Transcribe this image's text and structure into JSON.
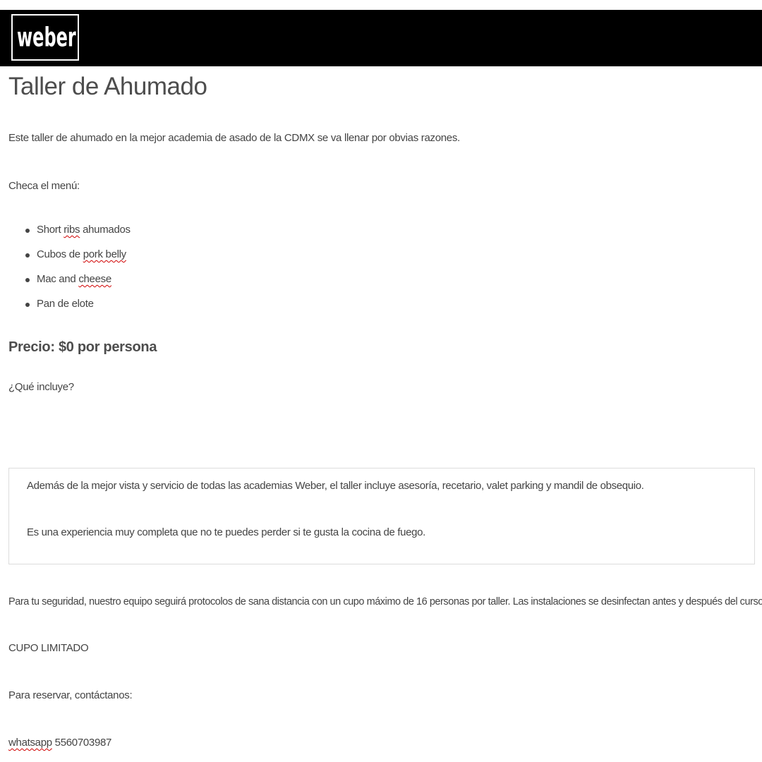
{
  "header": {
    "logo_text": "weber",
    "logo_icon": "kettle-grill-icon",
    "background_color": "#000000",
    "accent_color": "#e31b23"
  },
  "page": {
    "title": "Taller de Ahumado",
    "intro": "Este taller de ahumado en la mejor academia de asado de la CDMX se va llenar por obvias razones.",
    "menu_label": "Checa el menú:",
    "menu_items": [
      {
        "before": "Short ",
        "flagged": "ribs",
        "after": " ahumados"
      },
      {
        "before": "Cubos de ",
        "flagged": "pork belly",
        "after": ""
      },
      {
        "before": "Mac and ",
        "flagged": "cheese",
        "after": ""
      },
      {
        "before": "Pan de elote",
        "flagged": "",
        "after": ""
      }
    ],
    "price": "Precio: $0 por persona",
    "includes_label": "¿Qué incluye?",
    "quote": {
      "line1": "Además de la mejor vista y servicio de todas las academias Weber, el taller incluye asesoría, recetario, valet parking y mandil de obsequio.",
      "line2": "Es una experiencia muy completa que no te puedes perder si te gusta la cocina de fuego."
    },
    "safety": "Para tu seguridad, nuestro equipo seguirá protocolos de sana distancia con un cupo máximo de 16 personas por taller. Las instalaciones se desinfectan antes y después del curso.",
    "limited": "CUPO LIMITADO",
    "reserve": "Para reservar, contáctanos:",
    "contact": {
      "label": "whatsapp",
      "number": " 5560703987"
    }
  }
}
